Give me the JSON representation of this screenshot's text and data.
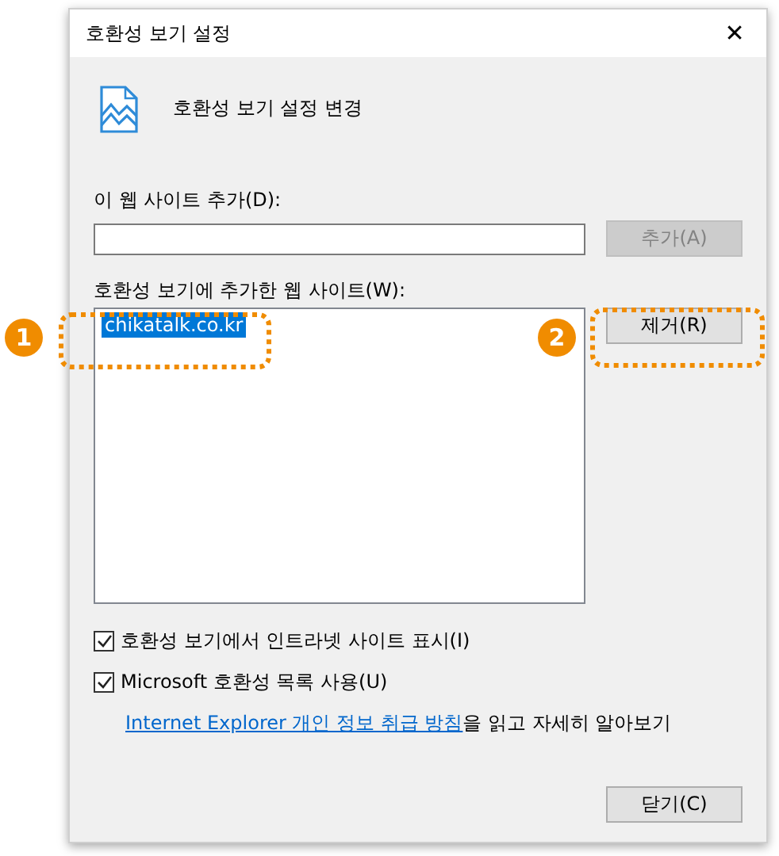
{
  "window": {
    "title": "호환성 보기 설정",
    "close": "✕"
  },
  "header": "호환성 보기 설정 변경",
  "add_site": {
    "label": "이 웹 사이트 추가(D):",
    "button": {
      "label": "추가(A)",
      "disabled": true
    }
  },
  "site_list": {
    "label": "호환성 보기에 추가한 웹 사이트(W):",
    "items": [
      {
        "text": "chikatalk.co.kr",
        "selected": true
      }
    ],
    "button": {
      "label": "제거(R)",
      "disabled": false
    }
  },
  "checkboxes": [
    {
      "label": "호환성 보기에서 인트라넷 사이트 표시(I)",
      "checked": true
    },
    {
      "label": "Microsoft 호환성 목록 사용(U)",
      "checked": true
    }
  ],
  "privacy": {
    "link": "Internet Explorer 개인 정보 취급 방침",
    "text": "을 읽고 자세히 알아보기"
  },
  "close_button": "닫기(C)",
  "callouts": [
    {
      "number": "1"
    },
    {
      "number": "2"
    }
  ]
}
